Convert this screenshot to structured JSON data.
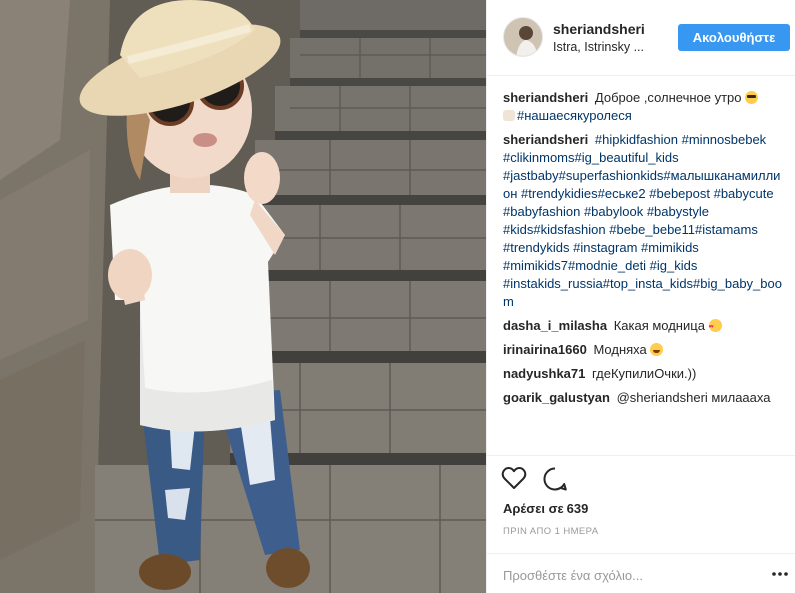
{
  "post": {
    "user": {
      "username": "sheriandsheri",
      "location": "Istra, Istrinsky ...",
      "follow_label": "Ακολουθήστε"
    },
    "comments": [
      {
        "user": "sheriandsheri",
        "text": "Доброе ,солнечное утро",
        "emoji_after": "sunglasses-emoji",
        "line2": "#нашаесякуролеся",
        "emoji_before_line2": "raised-hands-emoji"
      },
      {
        "user": "sheriandsheri",
        "text": "#hipkidfashion #minnosbebek #clikinmoms#ig_beautiful_kids #jastbaby#superfashionkids#малышканамиллион #trendykidies#еське2 #bebepost #babycute #babyfashion #babylook #babystyle #kids#kidsfashion #bebe_bebe11#istamams #trendykids #instagram #mimikids #mimikids7#modnie_deti #ig_kids #instakids_russia#top_insta_kids#big_baby_boom"
      },
      {
        "user": "dasha_i_milasha",
        "text": "Какая модница",
        "emoji_after": "heart-eyes-emoji"
      },
      {
        "user": "irinairina1660",
        "text": "Модняха",
        "emoji_after": "laughing-emoji"
      },
      {
        "user": "nadyushka71",
        "text": "гдеКупилиОчки.))"
      },
      {
        "user": "goarik_galustyan",
        "text": "@sheriandsheri милаааха"
      }
    ],
    "likes_label": "Αρέσει σε",
    "likes_count": "639",
    "time_label": "ΠΡΙΝ ΑΠΟ 1 ΗΜΕΡΑ",
    "add_comment_placeholder": "Προσθέστε ένα σχόλιο...",
    "icons": {
      "like": "heart-icon",
      "comment": "speech-bubble-icon",
      "more": "more-options-icon"
    }
  }
}
